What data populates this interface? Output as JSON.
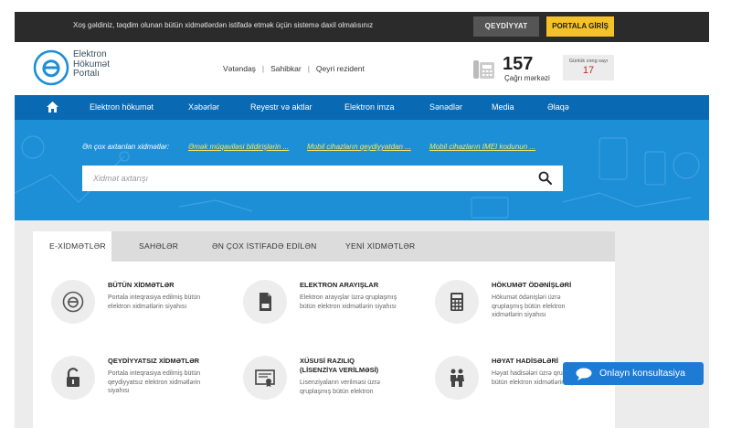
{
  "topbar": {
    "message": "Xoş gəldiniz, təqdim olunan bütün xidmətlərdən istifadə etmək üçün sistemə daxil olmalısınız",
    "register_label": "QEYDİYYAT",
    "login_label": "PORTALA GİRİŞ"
  },
  "header": {
    "logo_lines": [
      "Elektron",
      "Hökumət",
      "Portalı"
    ],
    "user_types": [
      "Vətəndaş",
      "Sahibkar",
      "Qeyri rezident"
    ],
    "call_number": "157",
    "call_label": "Çağrı mərkəzi",
    "daily_calls_label": "Günlük zəng sayı",
    "daily_calls_value": "17"
  },
  "nav": {
    "items": [
      "Elektron hökumət",
      "Xəbərlər",
      "Reyestr və aktlar",
      "Elektron imza",
      "Sənədlər",
      "Media",
      "Əlaqə"
    ]
  },
  "hero": {
    "popular_label": "Ən çox axtarılan xidmətlər:",
    "popular_links": [
      "Əmək müqaviləsi bildirişlərin ...",
      "Mobil cihazların qeydiyyatdan ...",
      "Mobil cihazların IMEI kodunun ..."
    ],
    "search_placeholder": "Xidmət axtarışı"
  },
  "tabs": [
    "E-XİDMƏTLƏR",
    "SAHƏLƏR",
    "ƏN ÇOX İSTİFADƏ EDİLƏN",
    "YENİ XİDMƏTLƏR"
  ],
  "services": [
    {
      "title": "BÜTÜN XİDMƏTLƏR",
      "desc": "Portala inteqrasiya edilmiş bütün elektron xidmətlərin siyahısı",
      "icon": "e-logo-icon"
    },
    {
      "title": "ELEKTRON ARAYIŞLAR",
      "desc": "Elektron arayışlar üzrə qruplaşmış bütün elektron xidmətlərin siyahısı",
      "icon": "document-icon"
    },
    {
      "title": "HÖKUMƏT ÖDƏNİŞLƏRİ",
      "desc": "Hökumət ödənişləri üzrə qruplaşmış bütün elektron xidmətlərin siyahısı",
      "icon": "calculator-icon"
    },
    {
      "title": "QEYDİYYATSIZ XİDMƏTLƏR",
      "desc": "Portala inteqrasiya edilmiş bütün qeydiyyatsız elektron xidmətlərin siyahısı",
      "icon": "unlock-icon"
    },
    {
      "title": "XÜSUSİ RAZILIQ\n(LİSENZİYA VERİLMƏSİ)",
      "desc": "Lisenziyaların verilməsi üzrə qruplaşmış bütün elektron",
      "icon": "certificate-icon"
    },
    {
      "title": "HƏYAT HADİSƏLƏRİ",
      "desc": "Həyat hadisələri üzrə qruplaşmış bütün elektron xidmətlərin siyahısı",
      "icon": "family-icon"
    }
  ],
  "consult": {
    "label": "Onlayn konsultasiya"
  },
  "colors": {
    "nav": "#0a69b3",
    "hero": "#1c8fd7",
    "accent_yellow": "#f5c128",
    "topbar": "#2b2b2b"
  }
}
